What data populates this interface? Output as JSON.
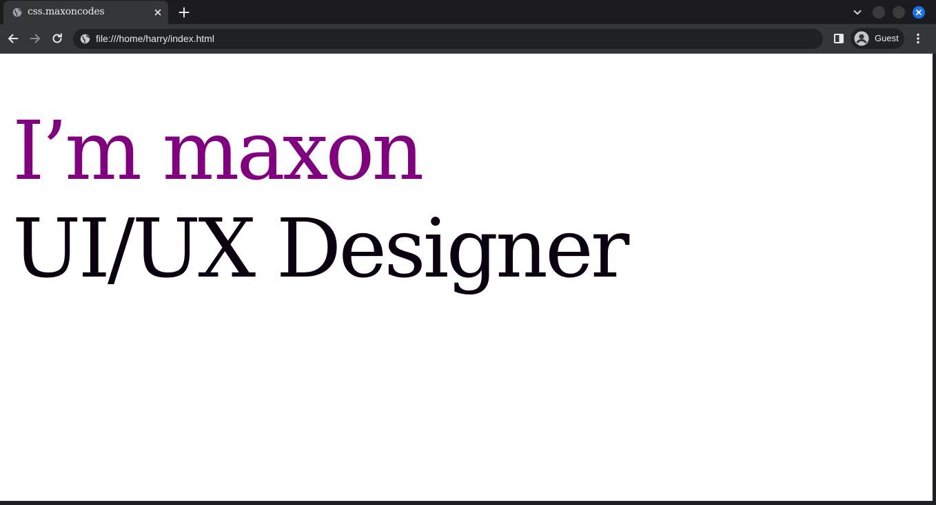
{
  "browser": {
    "tab": {
      "title": "css.maxoncodes",
      "favicon": "globe-icon"
    },
    "omnibox": {
      "url": "file:///home/harry/index.html"
    },
    "profile": {
      "label": "Guest"
    },
    "colors": {
      "tabstrip": "#1c1c20",
      "toolbar": "#35363a",
      "accent": "#1a73e8"
    }
  },
  "page": {
    "headline": "I’m maxon",
    "subhead": "UI/UX Designer",
    "colors": {
      "headline": "#800080",
      "subhead": "#0b000f",
      "background": "#ffffff"
    }
  }
}
